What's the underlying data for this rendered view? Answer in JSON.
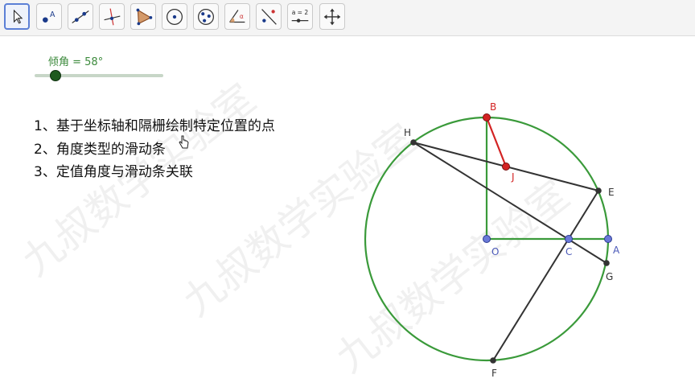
{
  "toolbar": {
    "tools": [
      {
        "name": "move-tool",
        "icon": "arrow-cursor-icon"
      },
      {
        "name": "point-tool",
        "icon": "point-icon",
        "label": "A"
      },
      {
        "name": "line-tool",
        "icon": "line-icon"
      },
      {
        "name": "perpendicular-line-tool",
        "icon": "perpendicular-icon"
      },
      {
        "name": "polygon-tool",
        "icon": "polygon-icon"
      },
      {
        "name": "circle-tool",
        "icon": "circle-center-point-icon"
      },
      {
        "name": "circle-three-points-tool",
        "icon": "circle-three-points-icon"
      },
      {
        "name": "angle-tool",
        "icon": "angle-icon",
        "label": "α"
      },
      {
        "name": "reflect-tool",
        "icon": "reflect-icon"
      },
      {
        "name": "slider-tool",
        "icon": "slider-icon",
        "label": "a = 2"
      },
      {
        "name": "move-view-tool",
        "icon": "move-graphics-icon"
      }
    ]
  },
  "slider": {
    "label": "倾角 = 58°",
    "value_degrees": 58
  },
  "notes": [
    "1、基于坐标轴和隔栅绘制特定位置的点",
    "2、角度类型的滑动条",
    "3、定值角度与滑动条关联"
  ],
  "points": {
    "B": "B",
    "H": "H",
    "J": "J",
    "E": "E",
    "O": "O",
    "C": "C",
    "A": "A",
    "G": "G",
    "F": "F"
  },
  "watermark": {
    "text": "九叔数学实验室"
  },
  "colors": {
    "circle": "#3a9a3a",
    "red": "#d32323",
    "blue_point": "#6a79d8",
    "dark": "#333333"
  }
}
